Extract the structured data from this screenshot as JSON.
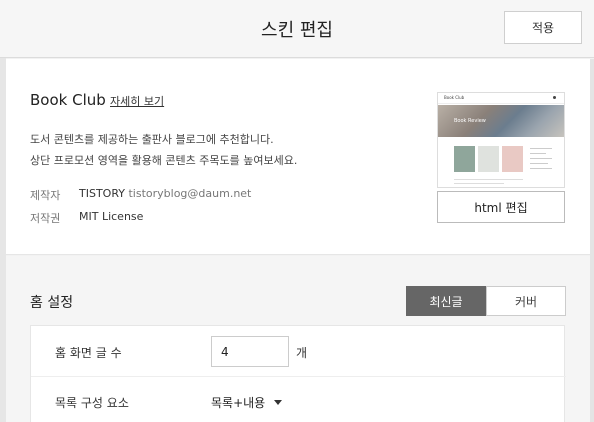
{
  "header": {
    "title": "스킨 편집",
    "apply_label": "적용"
  },
  "skin": {
    "name": "Book Club",
    "detail_link": "자세히 보기",
    "description_line1": "도서 콘텐츠를 제공하는 출판사 블로그에 추천합니다.",
    "description_line2": "상단 프로모션 영역을 활용해 콘텐츠 주목도를 높여보세요.",
    "maker_label": "제작자",
    "maker_name": "TISTORY",
    "maker_email": "tistoryblog@daum.net",
    "license_label": "저작권",
    "license_value": "MIT License",
    "preview": {
      "brand": "Book Club",
      "hero_text": "Book Review"
    },
    "html_edit_label": "html 편집"
  },
  "home": {
    "title": "홈 설정",
    "tabs": [
      {
        "label": "최신글",
        "active": true
      },
      {
        "label": "커버",
        "active": false
      }
    ],
    "posts_label": "홈 화면 글 수",
    "posts_value": "4",
    "posts_unit": "개",
    "list_label": "목록 구성 요소",
    "list_value": "목록+내용"
  },
  "colors": {
    "active_tab": "#666666",
    "page_bg": "#f2f2f2"
  }
}
